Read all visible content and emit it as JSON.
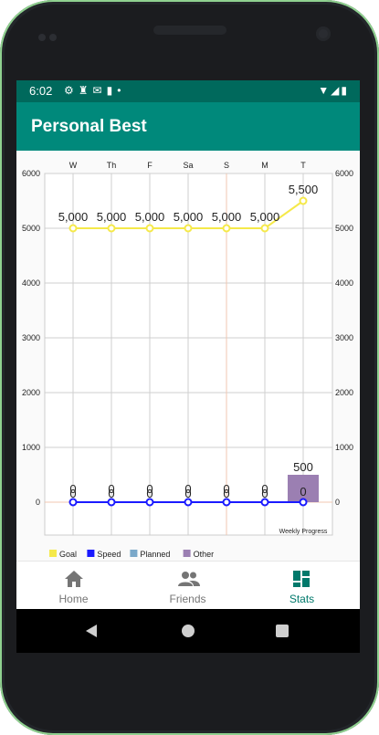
{
  "status_bar": {
    "time": "6:02",
    "left_icons": [
      "gear-icon",
      "figure-icon",
      "gmail-icon",
      "sd-card-icon",
      "dot-icon"
    ],
    "right_icons": [
      "wifi-icon",
      "signal-icon",
      "battery-icon"
    ]
  },
  "app_bar": {
    "title": "Personal Best"
  },
  "chart_data": {
    "type": "line",
    "categories": [
      "W",
      "Th",
      "F",
      "Sa",
      "S",
      "M",
      "T"
    ],
    "ylim": [
      0,
      6000
    ],
    "yticks": [
      "6000",
      "5000",
      "4000",
      "3000",
      "2000",
      "1000",
      "0"
    ],
    "series": [
      {
        "name": "Goal",
        "color": "#f5e94a",
        "values": [
          5000,
          5000,
          5000,
          5000,
          5000,
          5000,
          5500
        ],
        "labels": [
          "5,000",
          "5,000",
          "5,000",
          "5,000",
          "5,000",
          "5,000",
          "5,500"
        ]
      },
      {
        "name": "Speed",
        "color": "#1a1aff",
        "values": [
          0,
          0,
          0,
          0,
          0,
          0,
          0
        ]
      },
      {
        "name": "Planned",
        "color": "#7aa8c9",
        "values": [
          0,
          0,
          0,
          0,
          0,
          0,
          0
        ]
      },
      {
        "name": "Other",
        "color": "#9b7fb2",
        "values": [
          0,
          0,
          0,
          0,
          0,
          0,
          500
        ]
      }
    ],
    "bar_value_labels": [
      "0",
      "0",
      "0",
      "0",
      "0",
      "0",
      "500"
    ],
    "zero_labels": [
      "0",
      "0",
      "0",
      "0",
      "0",
      "0",
      "0"
    ],
    "bar_note": "Weekly Progress",
    "grid": true,
    "legend_position": "bottom-left"
  },
  "bottom_nav": {
    "items": [
      {
        "label": "Home",
        "icon": "home-icon",
        "active": false
      },
      {
        "label": "Friends",
        "icon": "people-icon",
        "active": false
      },
      {
        "label": "Stats",
        "icon": "dashboard-icon",
        "active": true
      }
    ],
    "active_color": "#00796b"
  },
  "system_nav": [
    "back-icon",
    "home-circle-icon",
    "recents-icon"
  ]
}
